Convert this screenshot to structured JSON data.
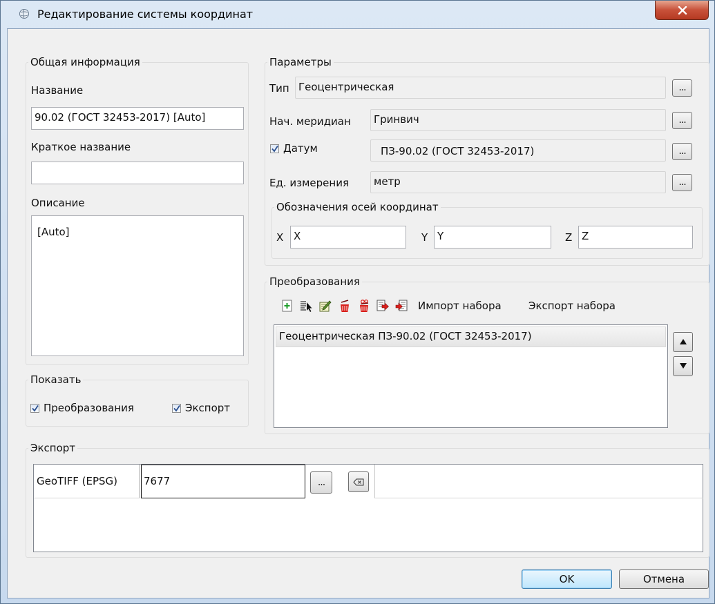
{
  "window": {
    "title": "Редактирование системы координат"
  },
  "general": {
    "legend": "Общая информация",
    "name_label": "Название",
    "name_value": "90.02 (ГОСТ 32453-2017) [Auto]",
    "short_name_label": "Краткое название",
    "short_name_value": "",
    "description_label": "Описание",
    "description_value": "[Auto]"
  },
  "show": {
    "legend": "Показать",
    "transforms_label": "Преобразования",
    "transforms_checked": true,
    "export_label": "Экспорт",
    "export_checked": true
  },
  "params": {
    "legend": "Параметры",
    "type_label": "Тип",
    "type_value": "Геоцентрическая",
    "meridian_label": "Нач. меридиан",
    "meridian_value": "Гринвич",
    "datum_label": "Датум",
    "datum_checked": true,
    "datum_value": "ПЗ-90.02 (ГОСТ 32453-2017)",
    "units_label": "Ед. измерения",
    "units_value": "метр",
    "dots": "...",
    "axes": {
      "legend": "Обозначения осей координат",
      "x_label": "X",
      "x_value": "X",
      "y_label": "Y",
      "y_value": "Y",
      "z_label": "Z",
      "z_value": "Z"
    }
  },
  "transforms": {
    "legend": "Преобразования",
    "toolbar_icons": [
      "add-icon",
      "select-icon",
      "edit-icon",
      "delete-icon",
      "delete-all-icon",
      "export-icon",
      "import-icon"
    ],
    "import_label": "Импорт набора",
    "export_label": "Экспорт набора",
    "items": [
      "Геоцентрическая ПЗ-90.02 (ГОСТ 32453-2017)"
    ]
  },
  "export": {
    "legend": "Экспорт",
    "row_label": "GeoTIFF (EPSG)",
    "row_value": "7677"
  },
  "buttons": {
    "ok": "OK",
    "cancel": "Отмена"
  },
  "colors": {
    "accent": "#3c7fb1",
    "close": "#c8513a",
    "red_icon": "#d9201c"
  }
}
